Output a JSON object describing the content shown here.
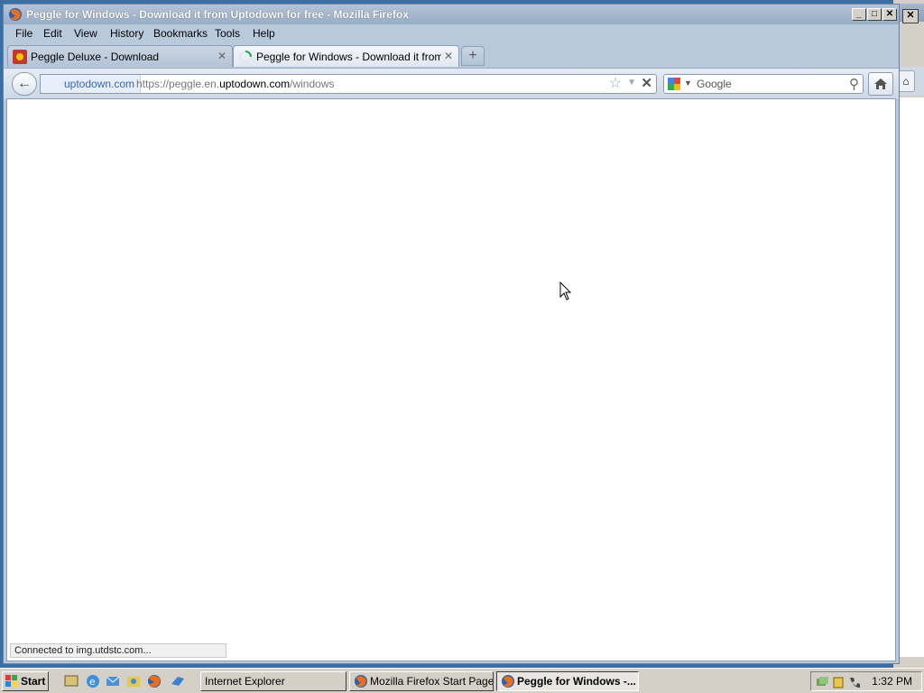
{
  "window": {
    "title": "Peggle for Windows - Download it from Uptodown for free - Mozilla Firefox",
    "min_glyph": "_",
    "max_glyph": "□",
    "close_glyph": "✕"
  },
  "menu": [
    "File",
    "Edit",
    "View",
    "History",
    "Bookmarks",
    "Tools",
    "Help"
  ],
  "tabs": [
    {
      "label": "Peggle Deluxe - Download",
      "close": "✕"
    },
    {
      "label": "Peggle for Windows - Download it from Up...",
      "close": "✕"
    }
  ],
  "new_tab_glyph": "+",
  "navbar": {
    "back_glyph": "←",
    "identity": "uptodown.com",
    "url_prefix": "https://peggle.en.",
    "url_domain": "uptodown.com",
    "url_path": "/windows",
    "star_glyph": "☆",
    "drop_glyph": "▼",
    "stop_glyph": "✕",
    "search_placeholder": "Google",
    "search_engine_drop": "▼",
    "mag_glyph": "⚲"
  },
  "status": "Connected to img.utdstc.com...",
  "taskbar": {
    "start": "Start",
    "tasks": [
      {
        "label": "Internet Explorer"
      },
      {
        "label": "Mozilla Firefox Start Page ..."
      },
      {
        "label": "Peggle for Windows -..."
      }
    ],
    "clock": "1:32 PM"
  },
  "bg_window": {
    "close_glyph": "✕",
    "home_glyph": "⌂"
  },
  "colors": {
    "titlebar": "#98acc6",
    "accent": "#3966b0"
  }
}
